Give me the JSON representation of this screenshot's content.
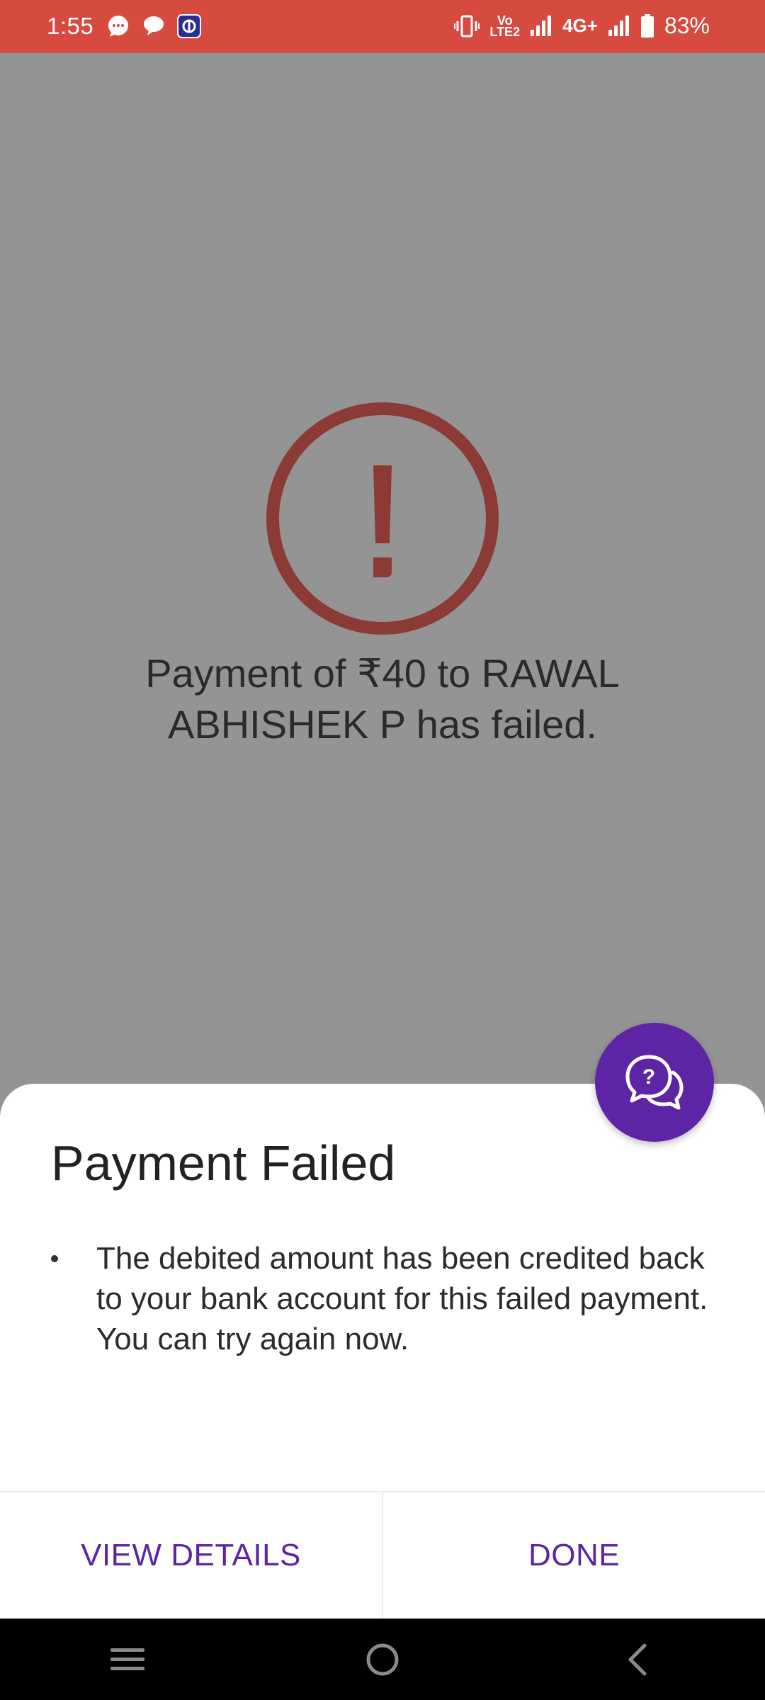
{
  "status_bar": {
    "time": "1:55",
    "battery_percent": "83%",
    "network_label": "4G+",
    "volte_label_top": "Vo",
    "volte_label_bottom": "LTE2",
    "left_icons": [
      "message-bubble-icon",
      "chat-bubbles-icon",
      "app-notification-icon"
    ],
    "right_icons": [
      "vibrate-icon",
      "volte-icon",
      "signal-icon",
      "signal-icon",
      "battery-icon"
    ]
  },
  "background": {
    "icon": "exclamation-circle-icon",
    "message": "Payment of ₹40 to RAWAL ABHISHEK P has failed."
  },
  "sheet": {
    "title": "Payment Failed",
    "body_line1": "The debited amount has been credited back to your bank account for this failed payment.",
    "body_line2": "You can try again now.",
    "view_details_label": "VIEW DETAILS",
    "done_label": "DONE"
  },
  "help_button": {
    "icon": "help-chat-icon"
  },
  "nav": {
    "icons": [
      "recents-icon",
      "home-icon",
      "back-icon"
    ]
  },
  "colors": {
    "status_bar": "#d64a3f",
    "accent": "#5d25a6",
    "error": "#8b3a36",
    "scrim": "#949494"
  }
}
